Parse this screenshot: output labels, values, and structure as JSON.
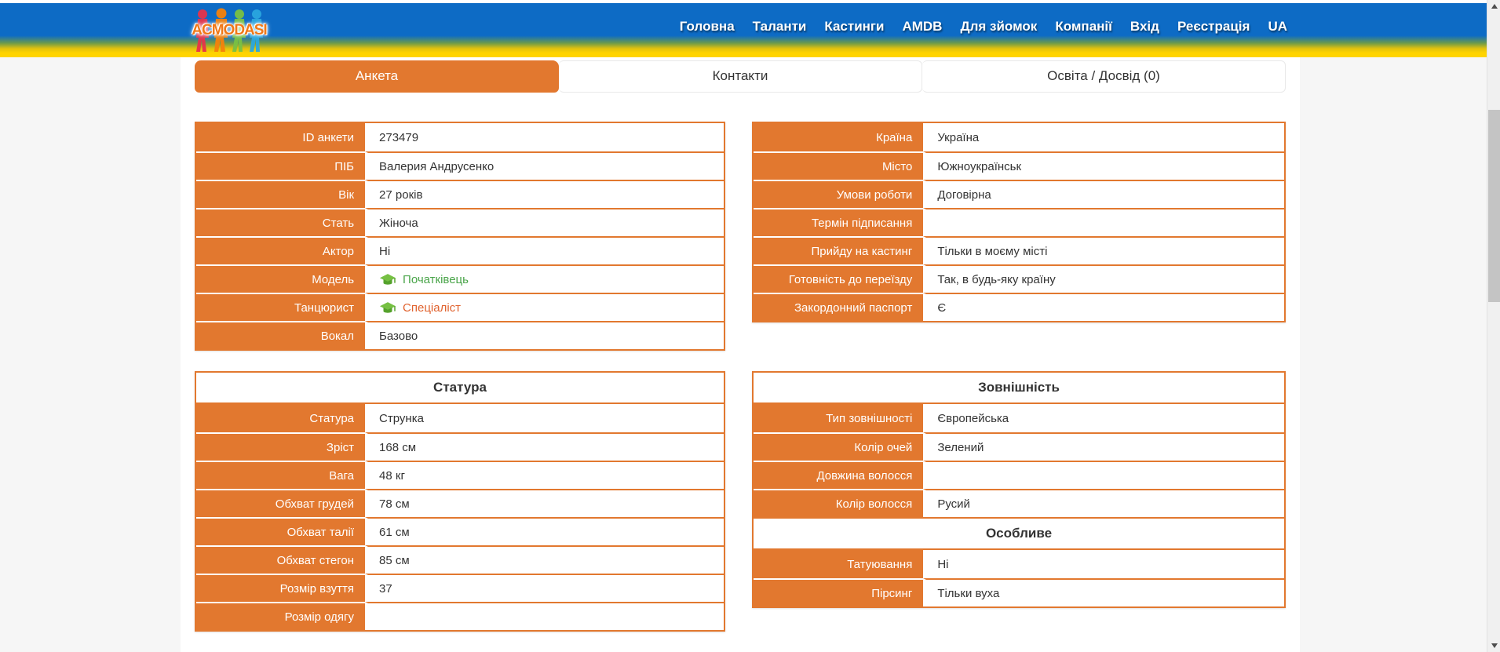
{
  "header": {
    "logo_text": "ACMODASI",
    "nav": [
      "Головна",
      "Таланти",
      "Кастинги",
      "AMDB",
      "Для зйомок",
      "Компанії",
      "Вхід",
      "Реєстрація",
      "UA"
    ]
  },
  "tabs": [
    {
      "label": "Анкета",
      "active": true
    },
    {
      "label": "Контакти",
      "active": false
    },
    {
      "label": "Освіта / Досвід (0)",
      "active": false
    }
  ],
  "icons": {
    "model_level": "graduation-cap-icon",
    "dancer_level": "graduation-cap-icon",
    "scrollbar_up": "triangle-up-icon",
    "scrollbar_down": "triangle-down-icon"
  },
  "colors": {
    "accent_orange": "#e2782f",
    "nav_blue": "#0d6bc5",
    "band_yellow": "#ffd400",
    "level_green": "#4aa54a",
    "level_orange": "#e0622e",
    "cap_green_light": "#76c043",
    "cap_green_dark": "#55a22c"
  },
  "tables": {
    "profile": {
      "rows": [
        {
          "label": "ID анкети",
          "value": "273479"
        },
        {
          "label": "ПІБ",
          "value": "Валерия Андрусенко"
        },
        {
          "label": "Вік",
          "value": "27 років"
        },
        {
          "label": "Стать",
          "value": "Жіноча"
        },
        {
          "label": "Актор",
          "value": "Ні"
        },
        {
          "label": "Модель",
          "value": "Початківець"
        },
        {
          "label": "Танцюрист",
          "value": "Спеціаліст"
        },
        {
          "label": "Вокал",
          "value": "Базово"
        }
      ]
    },
    "location": {
      "rows": [
        {
          "label": "Країна",
          "value": "Україна"
        },
        {
          "label": "Місто",
          "value": "Южноукраїнськ"
        },
        {
          "label": "Умови роботи",
          "value": "Договірна"
        },
        {
          "label": "Термін підписання",
          "value": ""
        },
        {
          "label": "Прийду на кастинг",
          "value": "Тільки в моєму місті"
        },
        {
          "label": "Готовність до переїзду",
          "value": "Так, в будь-яку країну"
        },
        {
          "label": "Закордонний паспорт",
          "value": "Є"
        }
      ]
    },
    "stature": {
      "title": "Статура",
      "rows": [
        {
          "label": "Статура",
          "value": "Струнка"
        },
        {
          "label": "Зріст",
          "value": "168 см"
        },
        {
          "label": "Вага",
          "value": "48 кг"
        },
        {
          "label": "Обхват грудей",
          "value": "78 см"
        },
        {
          "label": "Обхват талії",
          "value": "61 см"
        },
        {
          "label": "Обхват стегон",
          "value": "85 см"
        },
        {
          "label": "Розмір взуття",
          "value": "37"
        },
        {
          "label": "Розмір одягу",
          "value": ""
        }
      ]
    },
    "appearance": {
      "title": "Зовнішність",
      "rows": [
        {
          "label": "Тип зовнішності",
          "value": "Європейська"
        },
        {
          "label": "Колір очей",
          "value": "Зелений"
        },
        {
          "label": "Довжина волосся",
          "value": ""
        },
        {
          "label": "Колір волосся",
          "value": "Русий"
        }
      ],
      "special": {
        "title": "Особливе",
        "rows": [
          {
            "label": "Татуювання",
            "value": "Ні"
          },
          {
            "label": "Пірсинг",
            "value": "Тільки вуха"
          }
        ]
      }
    }
  }
}
